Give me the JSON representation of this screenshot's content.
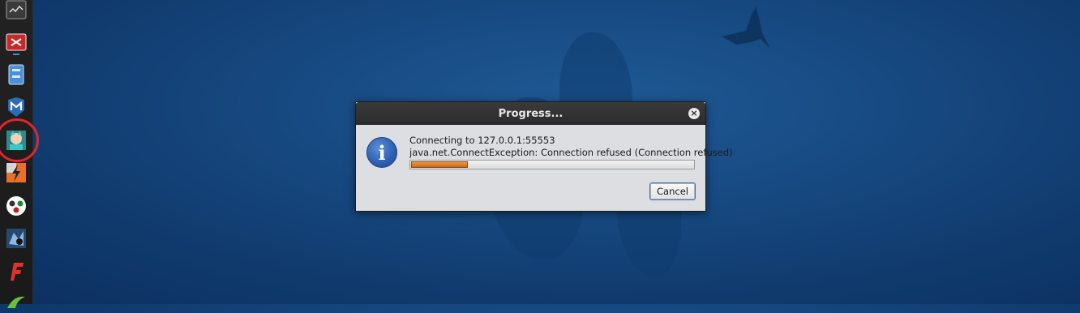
{
  "desktop": {
    "dock_icons": [
      "terminal-icon",
      "red-app-icon",
      "file-manager-icon",
      "metasploit-icon",
      "armitage-icon",
      "burpsuite-icon",
      "maltego-icon",
      "beef-icon",
      "faraday-icon",
      "kali-dragon-icon"
    ]
  },
  "dialog": {
    "title": "Progress...",
    "close_glyph": "×",
    "line1": "Connecting to 127.0.0.1:55553",
    "line2": "java.net.ConnectException: Connection refused (Connection refused)",
    "progress_fraction": 0.2,
    "cancel_label": "Cancel",
    "info_glyph": "i"
  },
  "colors": {
    "desktop_bg": "#174a82",
    "progress_fill": "#e07f28",
    "highlight_ring": "#e1262c"
  }
}
